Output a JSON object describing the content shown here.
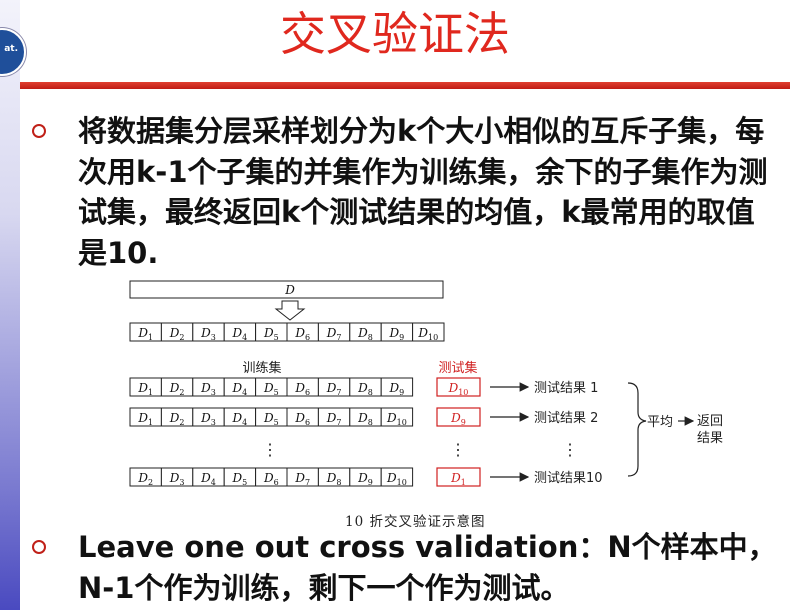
{
  "slide": {
    "title": "交叉验证法",
    "logo_text": "at.",
    "bullets": [
      "将数据集分层采样划分为k个大小相似的互斥子集，每次用k-1个子集的并集作为训练集，余下的子集作为测试集，最终返回k个测试结果的均值，k最常用的取值是10.",
      "Leave one out cross validation：N个样本中，N-1个作为训练，剩下一个作为测试。"
    ]
  },
  "diagram": {
    "top_label": "D",
    "split_labels": [
      "D1",
      "D2",
      "D3",
      "D4",
      "D5",
      "D6",
      "D7",
      "D8",
      "D9",
      "D10"
    ],
    "train_header": "训练集",
    "test_header": "测试集",
    "rows": [
      {
        "train": [
          "D1",
          "D2",
          "D3",
          "D4",
          "D5",
          "D6",
          "D7",
          "D8",
          "D9"
        ],
        "test": "D10",
        "result": "测试结果 1"
      },
      {
        "train": [
          "D1",
          "D2",
          "D3",
          "D4",
          "D5",
          "D6",
          "D7",
          "D8",
          "D10"
        ],
        "test": "D9",
        "result": "测试结果 2"
      },
      {
        "train": [
          "D2",
          "D3",
          "D4",
          "D5",
          "D6",
          "D7",
          "D8",
          "D9",
          "D10"
        ],
        "test": "D1",
        "result": "测试结果10"
      }
    ],
    "ellipsis": "⋮",
    "average_label": "平均",
    "return_label_1": "返回",
    "return_label_2": "结果",
    "caption": "10 折交叉验证示意图"
  },
  "colors": {
    "title": "#e0281e",
    "rule": "#c01c14",
    "test_box": "#d02020",
    "text": "#111111"
  }
}
